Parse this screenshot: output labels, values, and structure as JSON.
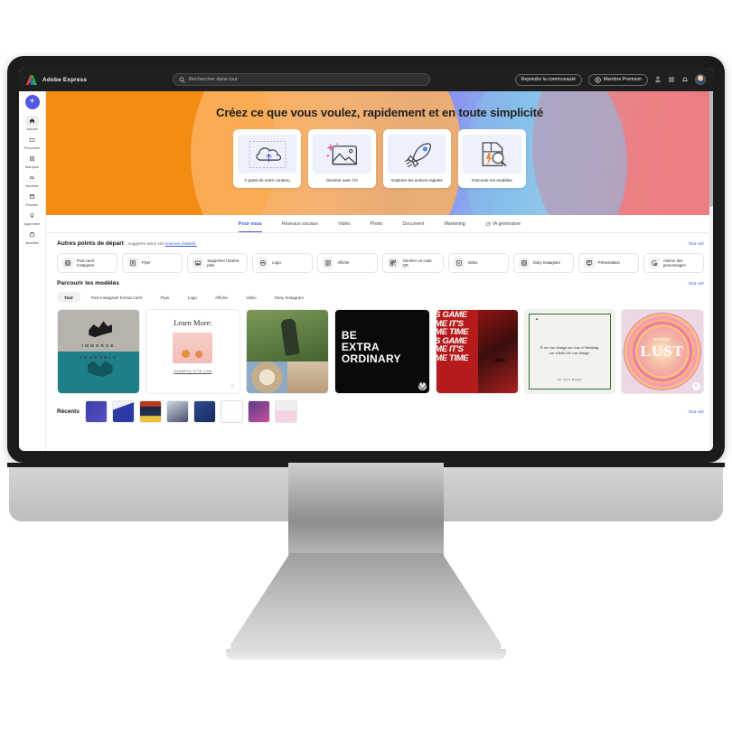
{
  "app": {
    "brand": "Adobe Express",
    "logo_icon": "adobe-logo-icon"
  },
  "search": {
    "placeholder": "Rechercher dans tout",
    "icon": "search-icon"
  },
  "topbar": {
    "community_button": "Rejoindre la communauté",
    "premium_button": "Membre Premium",
    "premium_icon": "premium-badge-icon",
    "icons": [
      "person-add-icon",
      "apps-grid-icon",
      "bell-icon"
    ],
    "avatar": "user-avatar"
  },
  "sidebar": {
    "create_button": "+",
    "items": [
      {
        "label": "Accueil",
        "icon": "home-icon",
        "active": true
      },
      {
        "label": "Personnel",
        "icon": "folder-icon",
        "active": false
      },
      {
        "label": "Marques",
        "icon": "brand-icon",
        "active": false
      },
      {
        "label": "Modèles",
        "icon": "templates-icon",
        "active": false
      },
      {
        "label": "Planifier",
        "icon": "calendar-icon",
        "active": false
      },
      {
        "label": "Apprendre",
        "icon": "lightbulb-icon",
        "active": false
      },
      {
        "label": "Modules",
        "icon": "modules-icon",
        "active": false
      }
    ]
  },
  "hero": {
    "title": "Créez ce que vous voulez, rapidement et en toute simplicité",
    "cards": [
      {
        "label": "À partir de votre contenu",
        "icon": "upload-cloud-icon"
      },
      {
        "label": "Générer avec l'IA",
        "icon": "ai-image-icon"
      },
      {
        "label": "Explorer les actions rapides",
        "icon": "rocket-icon"
      },
      {
        "label": "Parcourir les modèles",
        "icon": "search-doc-icon"
      }
    ]
  },
  "tabs": [
    {
      "label": "Pour vous",
      "active": true
    },
    {
      "label": "Réseaux sociaux",
      "active": false
    },
    {
      "label": "Vidéo",
      "active": false
    },
    {
      "label": "Photo",
      "active": false
    },
    {
      "label": "Document",
      "active": false
    },
    {
      "label": "Marketing",
      "active": false
    },
    {
      "label": "IA générative",
      "active": false,
      "icon": "sparkle-icon"
    }
  ],
  "starting_points": {
    "title": "Autres points de départ",
    "subtitle_prefix": "suggérés selon vos",
    "subtitle_link": "sources d'intérêt.",
    "see_all": "Tout voir",
    "chips": [
      {
        "label": "Post carré Instagram",
        "icon": "instagram-icon"
      },
      {
        "label": "Flyer",
        "icon": "flyer-icon"
      },
      {
        "label": "Supprimer l'arrière-plan",
        "icon": "remove-bg-icon"
      },
      {
        "label": "Logo",
        "icon": "logo-icon"
      },
      {
        "label": "Affiche",
        "icon": "poster-icon"
      },
      {
        "label": "Générer un code QR",
        "icon": "qr-code-icon"
      },
      {
        "label": "Vidéo",
        "icon": "video-icon"
      },
      {
        "label": "Story Instagram",
        "icon": "instagram-story-icon"
      },
      {
        "label": "Présentation",
        "icon": "presentation-icon"
      },
      {
        "label": "Animer des personnages",
        "icon": "animate-character-icon"
      }
    ]
  },
  "templates": {
    "title": "Parcourir les modèles",
    "see_all": "Tout voir",
    "filters": [
      {
        "label": "Tout",
        "active": true
      },
      {
        "label": "Post Instagram format carré",
        "active": false
      },
      {
        "label": "Flyer",
        "active": false
      },
      {
        "label": "Logo",
        "active": false
      },
      {
        "label": "Affiche",
        "active": false
      },
      {
        "label": "Vidéo",
        "active": false
      },
      {
        "label": "Story Instagram",
        "active": false
      }
    ],
    "items": [
      {
        "name": "immerse-yourself-diver",
        "line1": "IMMERSE",
        "line2": "YOURSELF"
      },
      {
        "name": "learn-more-card",
        "heading": "Learn More:",
        "url": "EXAMPLE-SITE.COM"
      },
      {
        "name": "outdoor-collage",
        "heading": "",
        "url": ""
      },
      {
        "name": "be-extra-ordinary",
        "l1": "BE",
        "l2": "EXTRA",
        "l3": "ORDINARY"
      },
      {
        "name": "its-game-time",
        "l1": "S GAME",
        "l2": "ME IT'S",
        "l3": "ME TIME",
        "l4": "S GAME",
        "l5": "ME IT'S",
        "l6": "ME TIME"
      },
      {
        "name": "quote-card",
        "quote_mark": "“",
        "quote": "If we can change our way of thinking, our whole life can change.",
        "author": "Dr. Kyle Hough"
      },
      {
        "name": "wander-lust",
        "script": "wander",
        "headline": "LUST"
      }
    ]
  },
  "recents": {
    "title": "Récents",
    "see_all": "Tout voir",
    "items": [
      {
        "name": "recent-thumb-1"
      },
      {
        "name": "recent-thumb-2"
      },
      {
        "name": "recent-thumb-3"
      },
      {
        "name": "recent-thumb-4"
      },
      {
        "name": "recent-thumb-5"
      },
      {
        "name": "recent-thumb-6"
      },
      {
        "name": "recent-thumb-7"
      },
      {
        "name": "recent-thumb-8"
      }
    ]
  },
  "colors": {
    "accent_blue": "#3b5bdb",
    "create_purple": "#5258e4",
    "topbar_dark": "#1f1f1f",
    "hero_orange": "#f79a21",
    "hero_periwinkle": "#8f8ef0",
    "hero_pink": "#ef7f85"
  }
}
